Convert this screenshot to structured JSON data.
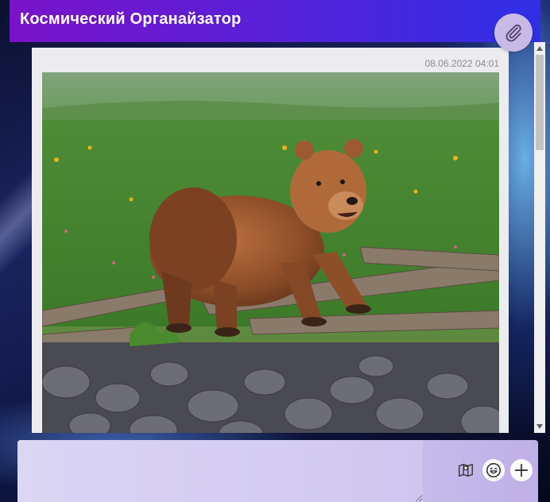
{
  "app": {
    "title": "Космический Органайзатор"
  },
  "header": {
    "title": "Космический Органайзатор",
    "attach_icon": "paperclip-icon"
  },
  "message": {
    "timestamp": "08.06.2022 04:01",
    "image_alt": "bear"
  },
  "composer": {
    "input_value": "",
    "placeholder": "",
    "icons": [
      "map-icon",
      "emoji-icon",
      "plus-icon"
    ]
  },
  "colors": {
    "header_start": "#7a12c9",
    "header_end": "#2f2fe6",
    "card": "#ececf0",
    "composer": "#cbc2ee",
    "attach_button": "#c9b9e6"
  }
}
